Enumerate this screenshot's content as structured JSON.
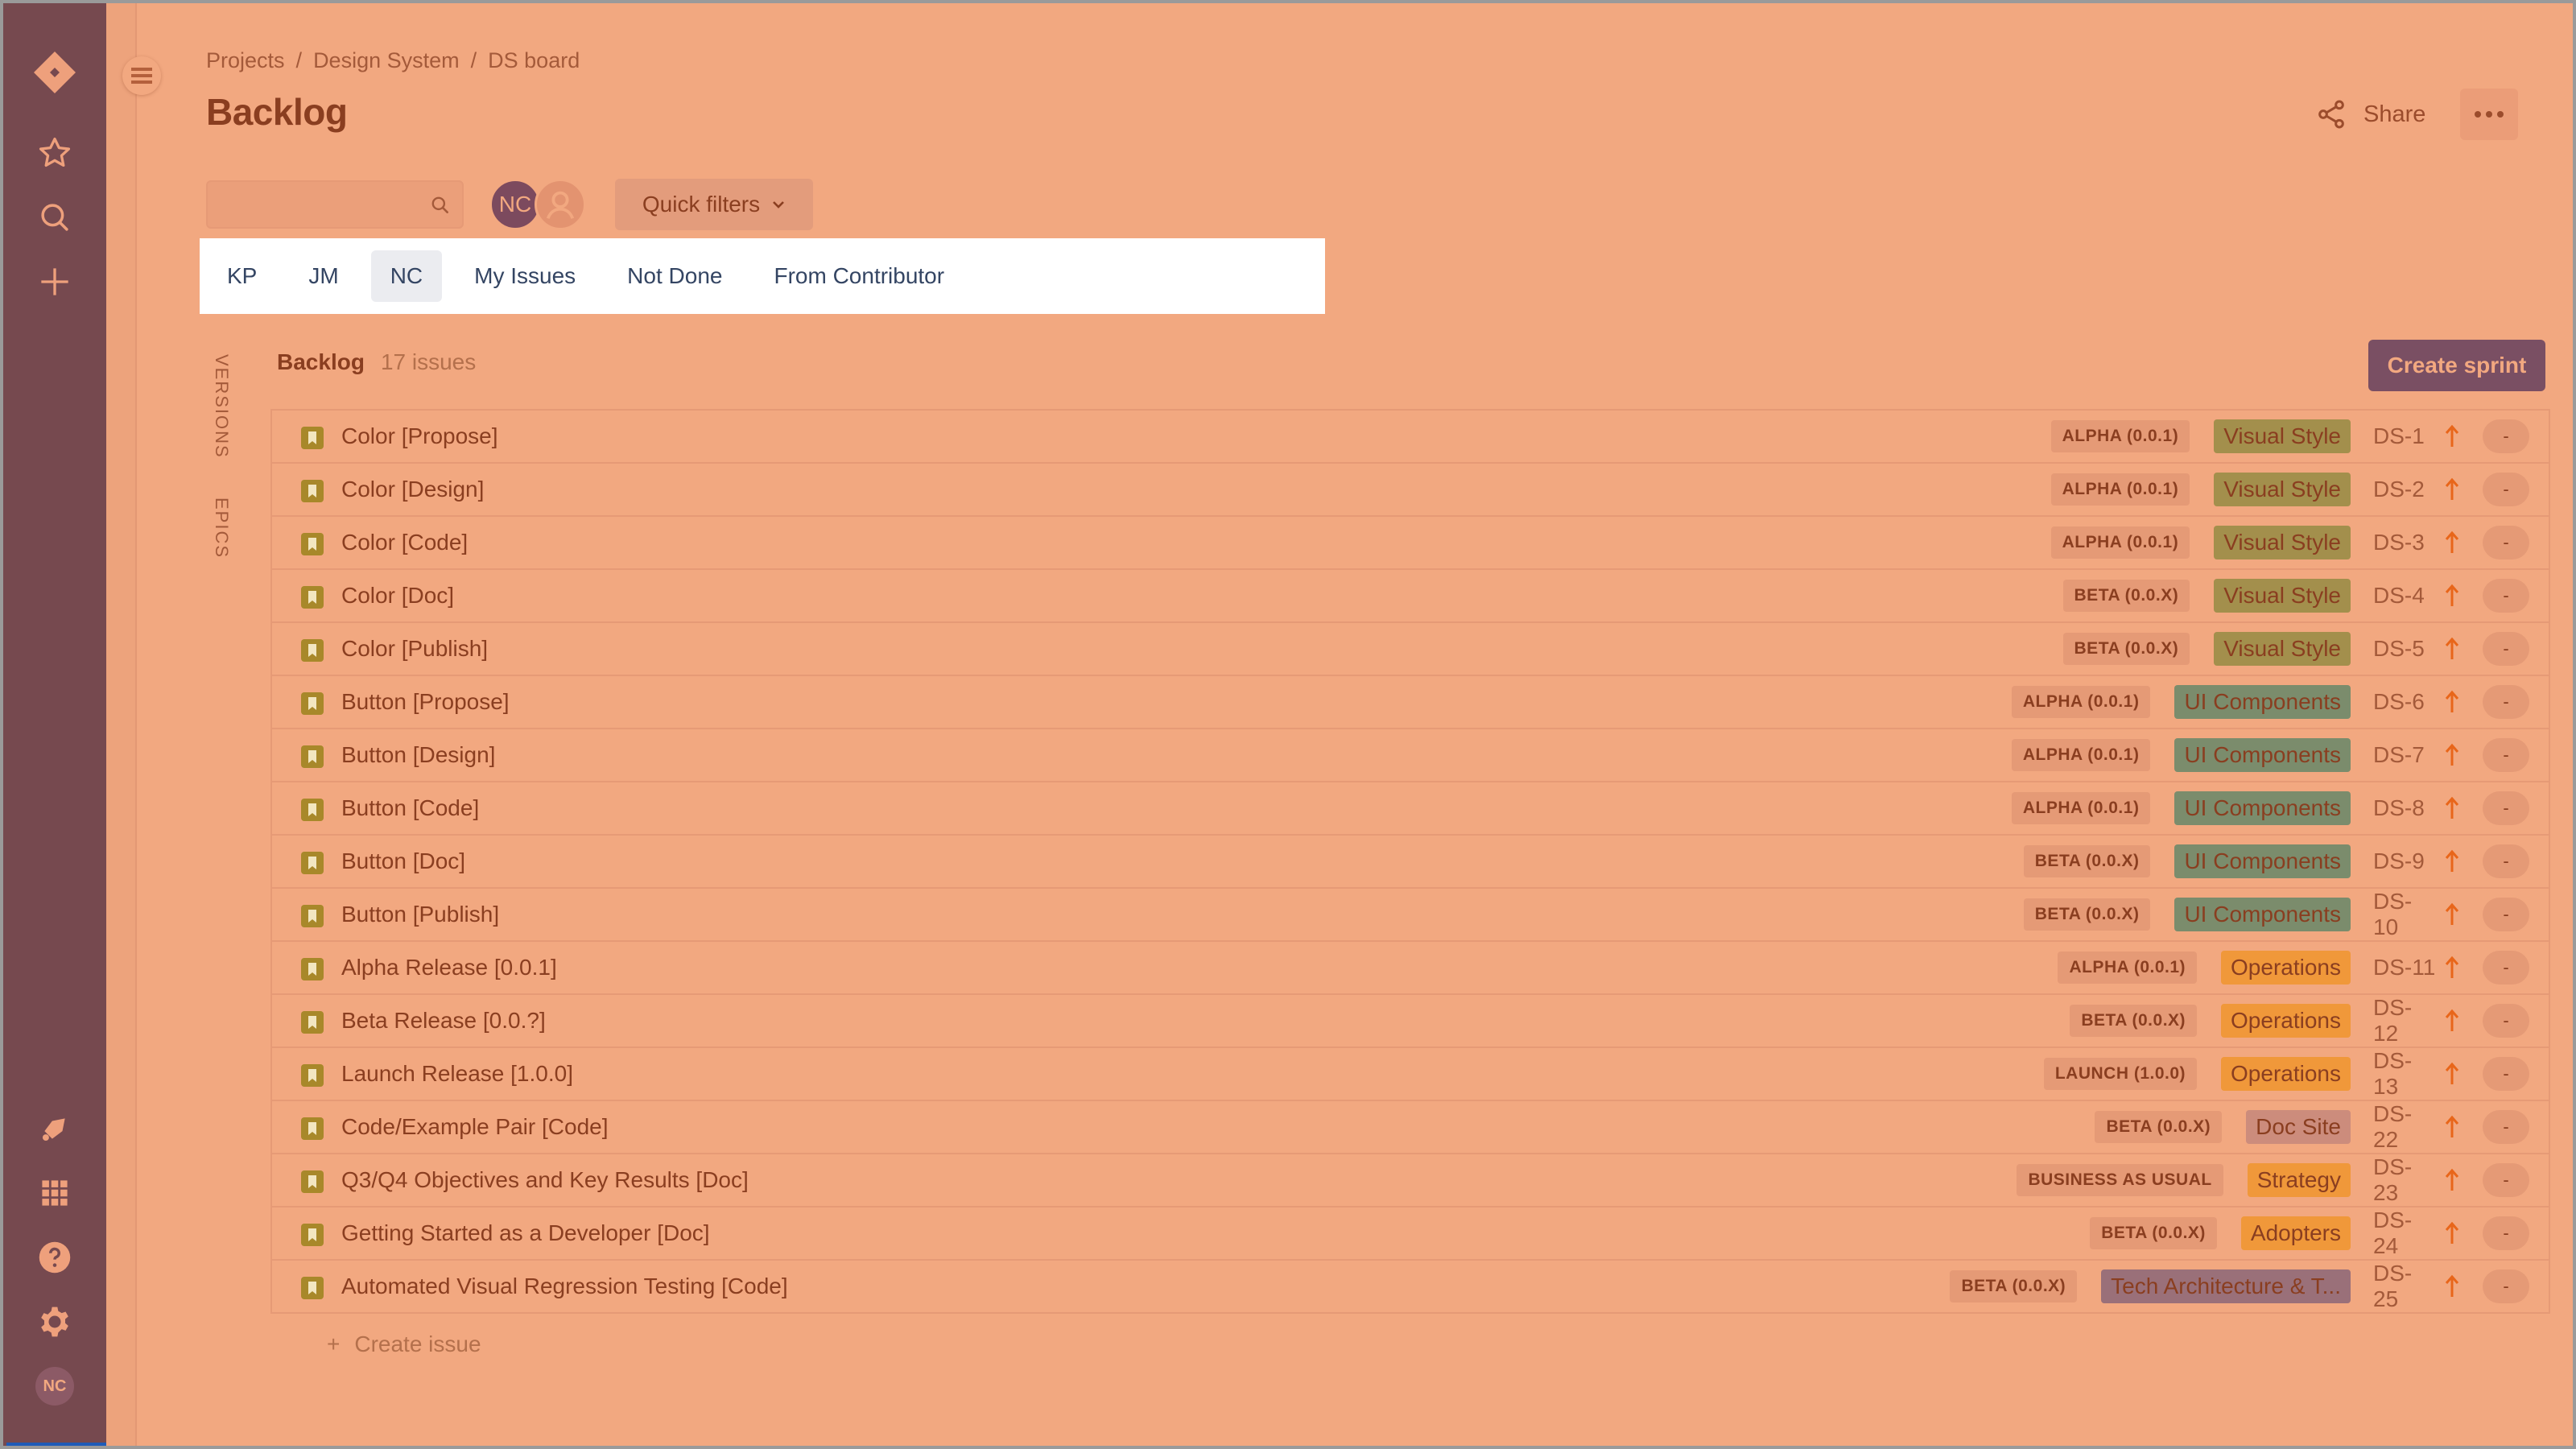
{
  "nav": {
    "top_icons": [
      "jira-logo-icon",
      "star-icon",
      "search-icon",
      "plus-icon"
    ],
    "bottom_icons": [
      "notification-icon",
      "app-switcher-icon",
      "help-icon",
      "settings-icon"
    ],
    "user_initials": "NC"
  },
  "header": {
    "breadcrumbs": [
      "Projects",
      "Design System",
      "DS board"
    ],
    "breadcrumb_separator": "/",
    "title": "Backlog",
    "share_label": "Share"
  },
  "toolbar": {
    "search_value": "",
    "search_placeholder": "",
    "avatar_initials": "NC",
    "quick_filters_label": "Quick filters"
  },
  "filters": [
    {
      "label": "KP",
      "active": false
    },
    {
      "label": "JM",
      "active": false
    },
    {
      "label": "NC",
      "active": true
    },
    {
      "label": "My Issues",
      "active": false
    },
    {
      "label": "Not Done",
      "active": false
    },
    {
      "label": "From Contributor",
      "active": false
    }
  ],
  "side_tabs": {
    "versions": "VERSIONS",
    "epics": "EPICS"
  },
  "backlog": {
    "title": "Backlog",
    "count": "17 issues",
    "create_sprint_label": "Create sprint",
    "create_issue_label": "Create issue",
    "create_issue_icon": "+"
  },
  "epic_colors": {
    "Visual Style": "#a38f4c",
    "UI Components": "#7b8c6c",
    "Operations": "#f0983a",
    "Doc Site": "#cc8c7c",
    "Strategy": "#f0983a",
    "Adopters": "#f0983a",
    "Tech Architecture & T...": "#9a7079"
  },
  "issues": [
    {
      "summary": "Color [Propose]",
      "version": "ALPHA (0.0.1)",
      "epic": "Visual Style",
      "key": "DS-1",
      "priority": "high",
      "estimate": "-"
    },
    {
      "summary": "Color [Design]",
      "version": "ALPHA (0.0.1)",
      "epic": "Visual Style",
      "key": "DS-2",
      "priority": "high",
      "estimate": "-"
    },
    {
      "summary": "Color [Code]",
      "version": "ALPHA (0.0.1)",
      "epic": "Visual Style",
      "key": "DS-3",
      "priority": "high",
      "estimate": "-"
    },
    {
      "summary": "Color [Doc]",
      "version": "BETA (0.0.X)",
      "epic": "Visual Style",
      "key": "DS-4",
      "priority": "high",
      "estimate": "-"
    },
    {
      "summary": "Color [Publish]",
      "version": "BETA (0.0.X)",
      "epic": "Visual Style",
      "key": "DS-5",
      "priority": "high",
      "estimate": "-"
    },
    {
      "summary": "Button [Propose]",
      "version": "ALPHA (0.0.1)",
      "epic": "UI Components",
      "key": "DS-6",
      "priority": "high",
      "estimate": "-"
    },
    {
      "summary": "Button [Design]",
      "version": "ALPHA (0.0.1)",
      "epic": "UI Components",
      "key": "DS-7",
      "priority": "high",
      "estimate": "-"
    },
    {
      "summary": "Button [Code]",
      "version": "ALPHA (0.0.1)",
      "epic": "UI Components",
      "key": "DS-8",
      "priority": "high",
      "estimate": "-"
    },
    {
      "summary": "Button [Doc]",
      "version": "BETA (0.0.X)",
      "epic": "UI Components",
      "key": "DS-9",
      "priority": "high",
      "estimate": "-"
    },
    {
      "summary": "Button [Publish]",
      "version": "BETA (0.0.X)",
      "epic": "UI Components",
      "key": "DS-10",
      "priority": "high",
      "estimate": "-"
    },
    {
      "summary": "Alpha Release [0.0.1]",
      "version": "ALPHA (0.0.1)",
      "epic": "Operations",
      "key": "DS-11",
      "priority": "high",
      "estimate": "-"
    },
    {
      "summary": "Beta Release [0.0.?]",
      "version": "BETA (0.0.X)",
      "epic": "Operations",
      "key": "DS-12",
      "priority": "high",
      "estimate": "-"
    },
    {
      "summary": "Launch Release [1.0.0]",
      "version": "LAUNCH (1.0.0)",
      "epic": "Operations",
      "key": "DS-13",
      "priority": "high",
      "estimate": "-"
    },
    {
      "summary": "Code/Example Pair [Code]",
      "version": "BETA (0.0.X)",
      "epic": "Doc Site",
      "key": "DS-22",
      "priority": "high",
      "estimate": "-"
    },
    {
      "summary": "Q3/Q4 Objectives and Key Results [Doc]",
      "version": "BUSINESS AS USUAL",
      "epic": "Strategy",
      "key": "DS-23",
      "priority": "high",
      "estimate": "-"
    },
    {
      "summary": "Getting Started as a Developer [Doc]",
      "version": "BETA (0.0.X)",
      "epic": "Adopters",
      "key": "DS-24",
      "priority": "high",
      "estimate": "-"
    },
    {
      "summary": "Automated Visual Regression Testing [Code]",
      "version": "BETA (0.0.X)",
      "epic": "Tech Architecture & T...",
      "key": "DS-25",
      "priority": "high",
      "estimate": "-"
    }
  ],
  "colors": {
    "page_bg": "#f2a880",
    "nav_bg": "#76494f",
    "primary_button": "#7a4f63",
    "story_icon": "#a8882a",
    "priority_arrow": "#e8661a"
  }
}
